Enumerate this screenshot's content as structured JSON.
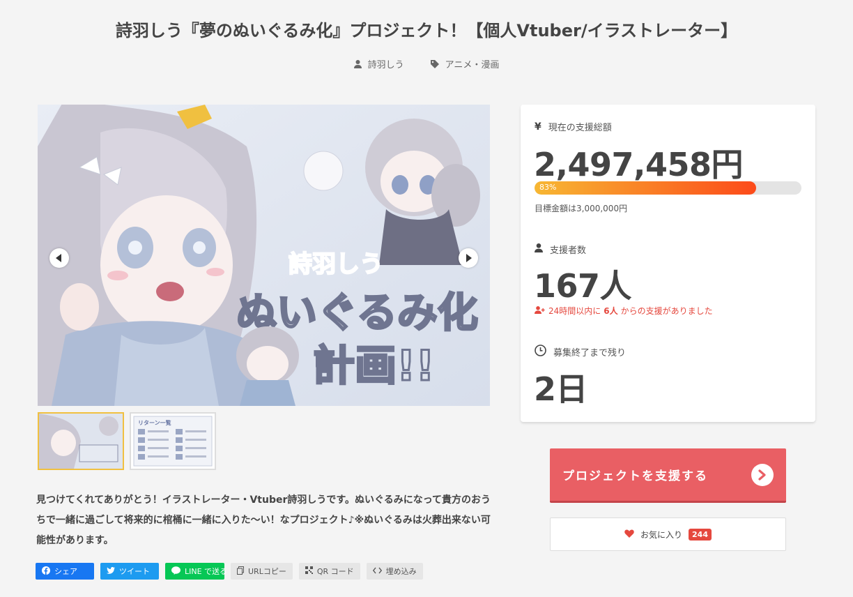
{
  "title": "詩羽しう『夢のぬいぐるみ化』プロジェクト！【個人Vtuber/イラストレーター】",
  "meta": {
    "author": "詩羽しう",
    "category": "アニメ・漫画"
  },
  "hero": {
    "title_top": "詩羽しう",
    "title_mid": "ぬいぐるみ化",
    "title_bottom": "計画!!",
    "thumb2_heading": "リターン一覧"
  },
  "description": "見つけてくれてありがとう！イラストレーター・Vtuber詩羽しうです。ぬいぐるみになって貴方のおうちで一緒に過ごして将来的に棺桶に一緒に入りた〜い！なプロジェクト♪※ぬいぐるみは火葬出来ない可能性があります。",
  "share": {
    "facebook": "シェア",
    "twitter": "ツイート",
    "line": "LINE で送る",
    "url_copy": "URLコピー",
    "qr": "QR コード",
    "embed": "埋め込み"
  },
  "stats": {
    "total_label": "現在の支援総額",
    "total_value": "2,497,458円",
    "progress_percent": 83,
    "progress_text": "83%",
    "goal_text": "目標金額は3,000,000円",
    "backers_label": "支援者数",
    "backers_value": "167人",
    "recent_prefix": "24時間以内に",
    "recent_count": "6人",
    "recent_suffix": "からの支援がありました",
    "remaining_label": "募集終了まで残り",
    "remaining_value": "2日"
  },
  "actions": {
    "support": "プロジェクトを支援する",
    "favorite": "お気に入り",
    "favorite_count": "244"
  },
  "colors": {
    "support_button": "#e95f64",
    "progress_start": "#f7b733",
    "progress_end": "#fc4a1a",
    "alert": "#e5483e",
    "facebook": "#1877f2",
    "twitter": "#1d9bf0",
    "line": "#06c755"
  }
}
